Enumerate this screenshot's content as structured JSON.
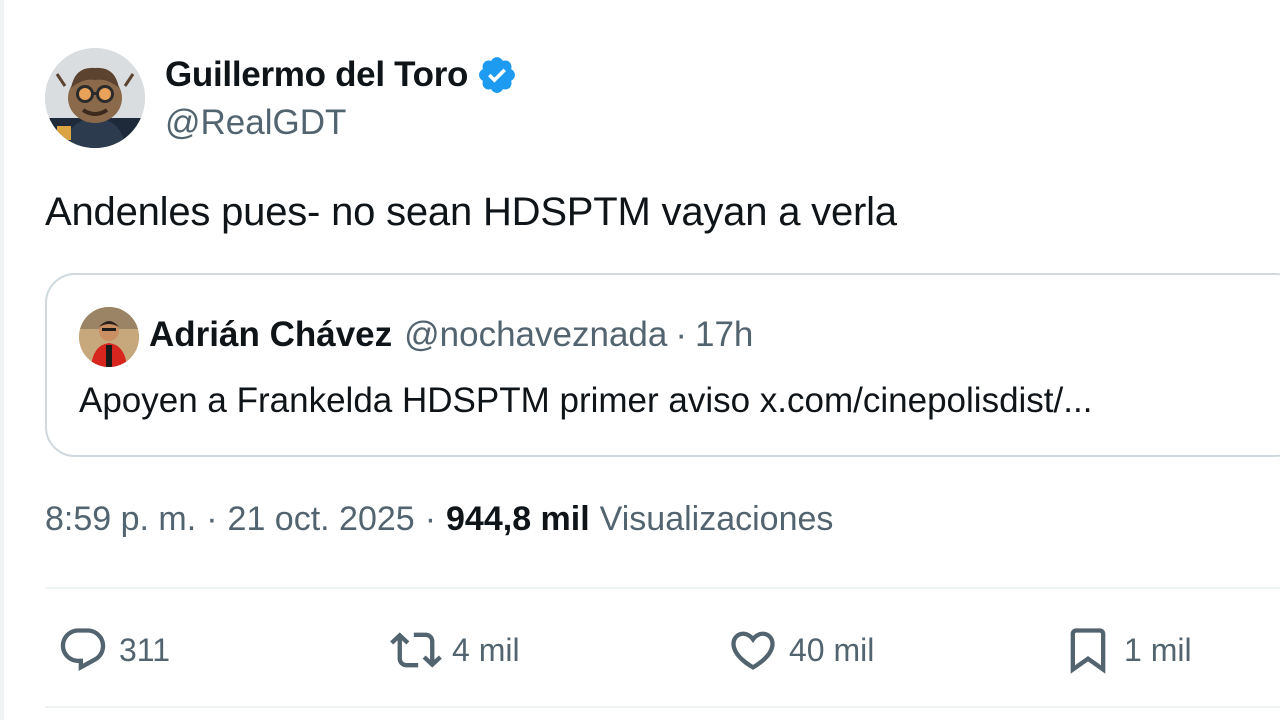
{
  "author": {
    "name": "Guillermo del Toro",
    "handle": "@RealGDT",
    "verified_icon": "verified-badge-icon"
  },
  "tweet": {
    "text": "Andenles pues- no sean HDSPTM vayan a verla"
  },
  "quoted": {
    "name": "Adrián Chávez",
    "handle": "@nochaveznada",
    "dot": "·",
    "time": "17h",
    "text": "Apoyen a Frankelda HDSPTM primer aviso x.com/cinepolisdist/..."
  },
  "meta": {
    "time": "8:59 p. m.",
    "sep1": "·",
    "date": "21 oct. 2025",
    "sep2": "·",
    "views_count": "944,8 mil",
    "views_label": "Visualizaciones"
  },
  "actions": {
    "replies": "311",
    "reposts": "4 mil",
    "likes": "40 mil",
    "bookmarks": "1 mil"
  },
  "colors": {
    "accent": "#1d9bf0",
    "text": "#0f1419",
    "secondary": "#536471",
    "border": "#cfd9de"
  }
}
